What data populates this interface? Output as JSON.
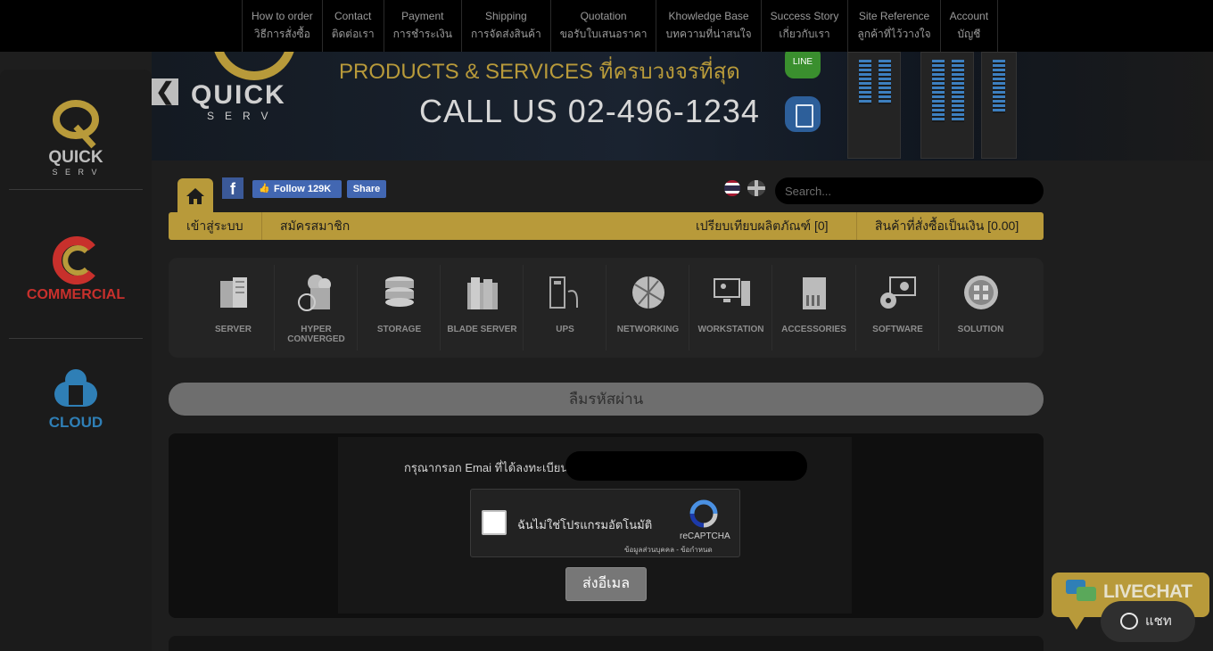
{
  "topnav": [
    {
      "en": "How to order",
      "th": "วิธีการสั่งซื้อ"
    },
    {
      "en": "Contact",
      "th": "ติดต่อเรา"
    },
    {
      "en": "Payment",
      "th": "การชำระเงิน"
    },
    {
      "en": "Shipping",
      "th": "การจัดส่งสินค้า"
    },
    {
      "en": "Quotation",
      "th": "ขอรับใบเสนอราคา"
    },
    {
      "en": "Khowledge Base",
      "th": "บทความที่น่าสนใจ"
    },
    {
      "en": "Success Story",
      "th": "เกี่ยวกับเรา"
    },
    {
      "en": "Site Reference",
      "th": "ลูกค้าที่ไว้วางใจ"
    },
    {
      "en": "Account",
      "th": "บัญชี"
    }
  ],
  "sidebar": {
    "quick": {
      "name": "QUICK",
      "sub": "S E R V"
    },
    "commercial": {
      "name": "COMMERCIAL"
    },
    "cloud": {
      "name": "CLOUD"
    }
  },
  "banner": {
    "back_symbol": "❮",
    "logo_name": "QUICK",
    "logo_sub": "SERV",
    "products": "PRODUCTS & SERVICES ที่ครบวงจรที่สุด",
    "call": "CALL US  02-496-1234",
    "line_label": "LINE"
  },
  "toolbar": {
    "fb_letter": "f",
    "follow": "Follow 129K",
    "share": "Share",
    "search_placeholder": "Search..."
  },
  "goldbar": {
    "login": "เข้าสู่ระบบ",
    "register": "สมัครสมาชิก",
    "compare": "เปรียบเทียบผลิตภัณฑ์ [0]",
    "cart": "สินค้าที่สั่งซื้อเป็นเงิน [0.00]"
  },
  "categories": [
    {
      "label": "SERVER",
      "icon": "server-icon"
    },
    {
      "label": "HYPER CONVERGED",
      "icon": "hyper-converged-icon"
    },
    {
      "label": "STORAGE",
      "icon": "storage-icon"
    },
    {
      "label": "BLADE SERVER",
      "icon": "blade-server-icon"
    },
    {
      "label": "UPS",
      "icon": "ups-icon"
    },
    {
      "label": "NETWORKING",
      "icon": "networking-icon"
    },
    {
      "label": "WORKSTATION",
      "icon": "workstation-icon"
    },
    {
      "label": "ACCESSORIES",
      "icon": "accessories-icon"
    },
    {
      "label": "SOFTWARE",
      "icon": "software-icon"
    },
    {
      "label": "SOLUTION",
      "icon": "solution-icon"
    }
  ],
  "forgot": {
    "title": "ลืมรหัสผ่าน",
    "email_label": "กรุณากรอก Emai ที่ได้ลงทะเบียน :",
    "email_value": "",
    "recaptcha_label": "ฉันไม่ใช่โปรแกรมอัตโนมัติ",
    "recaptcha_brand": "reCAPTCHA",
    "recaptcha_terms": "ข้อมูลส่วนบุคคล - ข้อกำหนด",
    "send": "ส่งอีเมล"
  },
  "livechat": {
    "banner": "LIVECHAT",
    "chat": "แชท"
  },
  "colors": {
    "gold": "#b89a3a",
    "background": "#1e1e1e",
    "commercial_red": "#c8302c",
    "cloud_blue": "#2f7fb6"
  }
}
